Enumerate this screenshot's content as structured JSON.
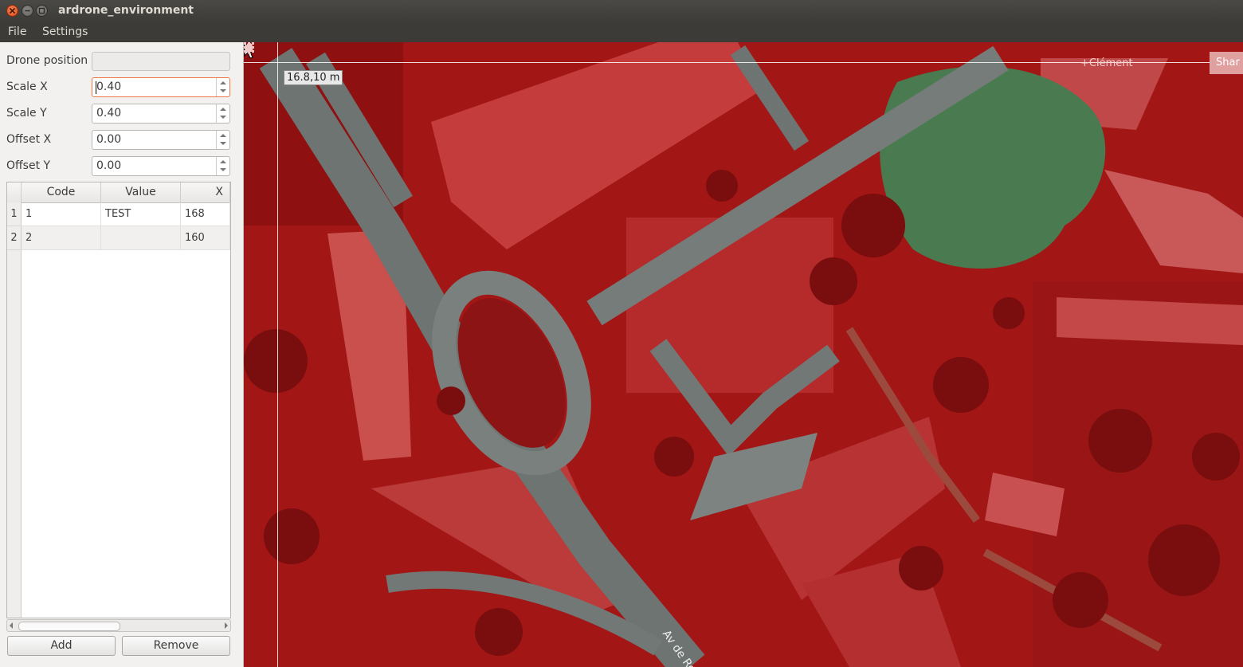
{
  "window": {
    "title": "ardrone_environment"
  },
  "menu": {
    "file": "File",
    "settings": "Settings"
  },
  "form": {
    "drone_position_label": "Drone position",
    "drone_position_value": "",
    "scale_x_label": "Scale X",
    "scale_x_value": "0.40",
    "scale_y_label": "Scale Y",
    "scale_y_value": "0.40",
    "offset_x_label": "Offset X",
    "offset_x_value": "0.00",
    "offset_y_label": "Offset Y",
    "offset_y_value": "0.00"
  },
  "table": {
    "headers": [
      "Code",
      "Value",
      "X"
    ],
    "rows": [
      {
        "index": "1",
        "code": "1",
        "value": "TEST",
        "x": "168"
      },
      {
        "index": "2",
        "code": "2",
        "value": "",
        "x": "160"
      }
    ]
  },
  "buttons": {
    "add": "Add",
    "remove": "Remove"
  },
  "map": {
    "coordinate_tooltip": "16.8,10 m",
    "user_name": "+Clément",
    "share_label": "Shar",
    "road_label": "Av de Ro"
  },
  "colors": {
    "accent_focus": "#f07746",
    "overlay_red": "#a01414",
    "title_bar": "#3c3b37"
  }
}
